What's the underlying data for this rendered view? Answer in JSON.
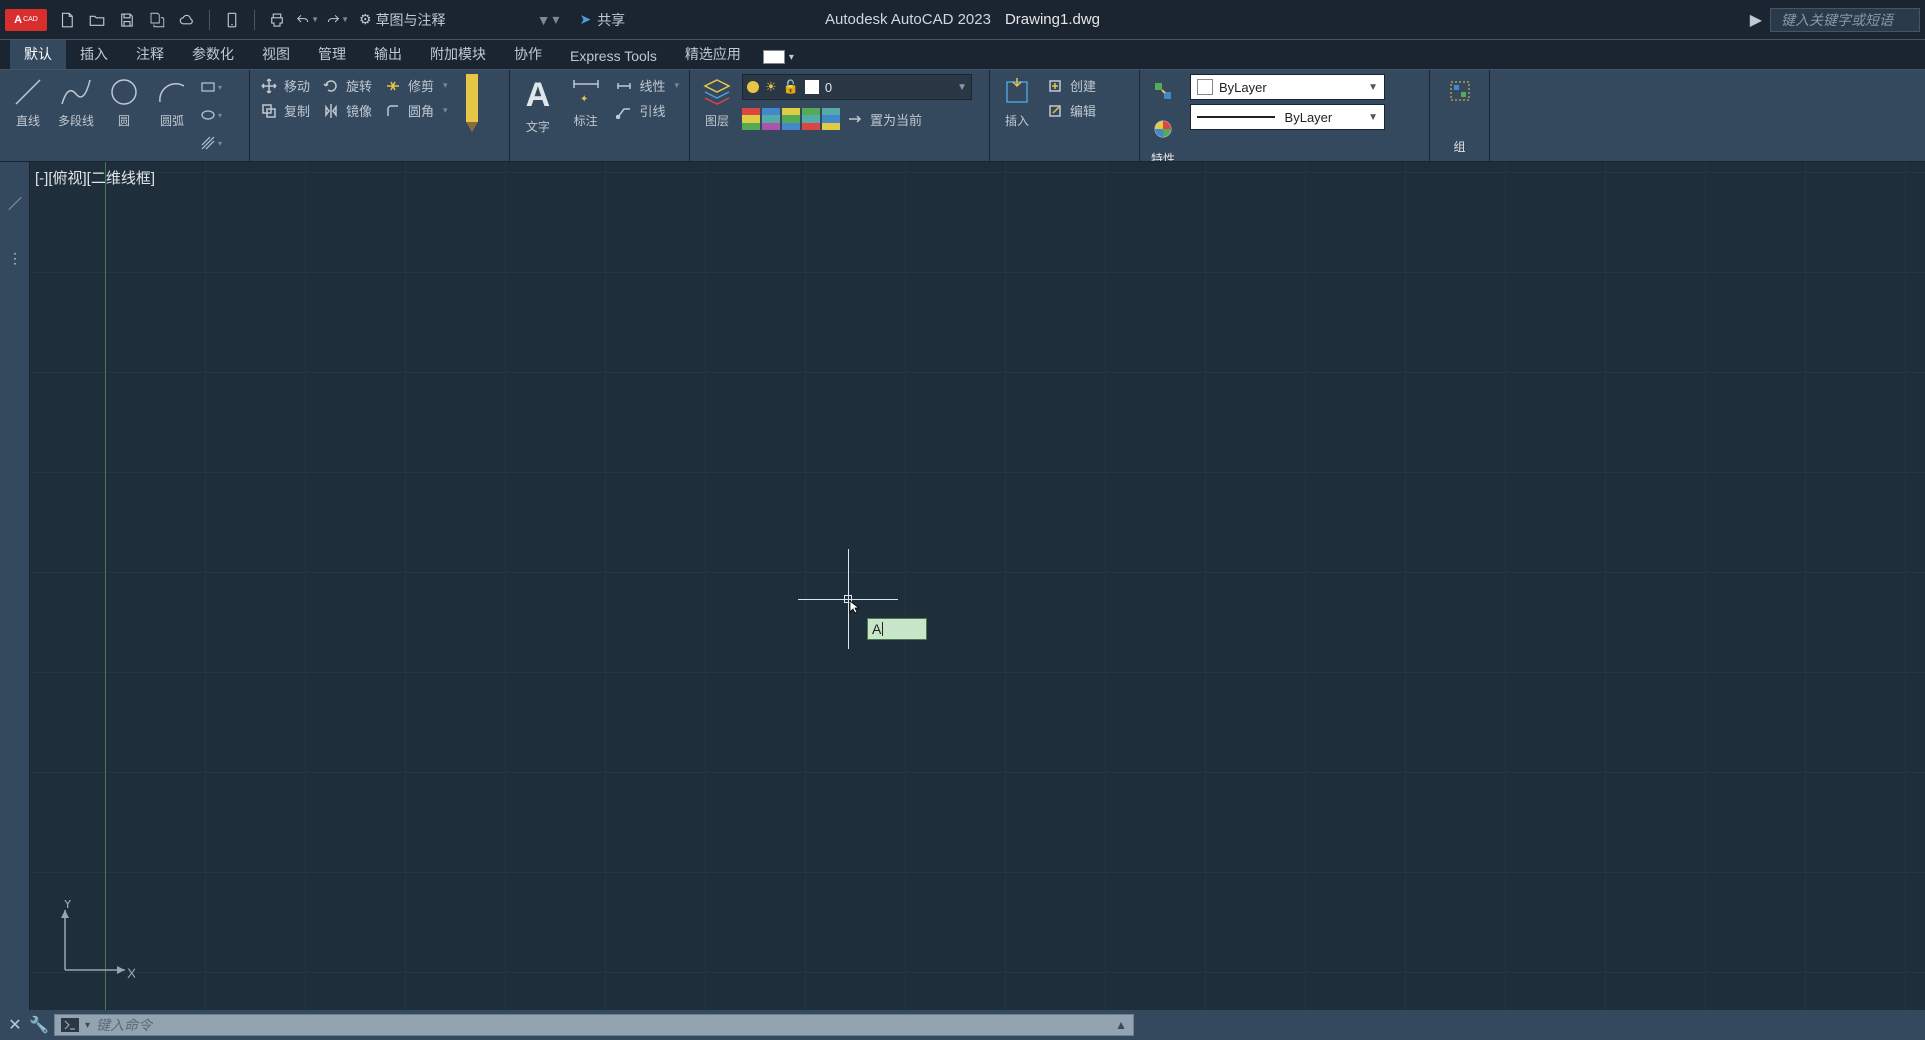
{
  "titlebar": {
    "logo": "A",
    "logo_sub": "CAD",
    "app_name": "Autodesk AutoCAD 2023",
    "doc_name": "Drawing1.dwg",
    "workspace": "草图与注释",
    "share": "共享",
    "search_placeholder": "键入关键字或短语"
  },
  "tabs": [
    "默认",
    "插入",
    "注释",
    "参数化",
    "视图",
    "管理",
    "输出",
    "附加模块",
    "协作",
    "Express Tools",
    "精选应用"
  ],
  "active_tab_index": 0,
  "ribbon": {
    "draw": {
      "line": "直线",
      "polyline": "多段线",
      "circle": "圆",
      "arc": "圆弧"
    },
    "modify": {
      "move": "移动",
      "copy": "复制",
      "rotate": "旋转",
      "mirror": "镜像",
      "trim": "修剪",
      "fillet": "圆角"
    },
    "annotate": {
      "text": "文字",
      "dim": "标注",
      "linetype": "线性",
      "leader": "引线"
    },
    "layers": {
      "panel_label": "图层",
      "current_layer": "0",
      "set_current": "置为当前"
    },
    "block": {
      "insert": "插入",
      "create": "创建",
      "edit": "编辑"
    },
    "props": {
      "panel_label": "特性",
      "color": "ByLayer",
      "lineweight": "ByLayer"
    },
    "group": {
      "panel_label": "组"
    }
  },
  "viewport_label": "[-][俯视][二维线框]",
  "ucs": {
    "x": "X",
    "y": "Y"
  },
  "dyn_input": "A",
  "cmdline": {
    "placeholder": "键入命令"
  }
}
